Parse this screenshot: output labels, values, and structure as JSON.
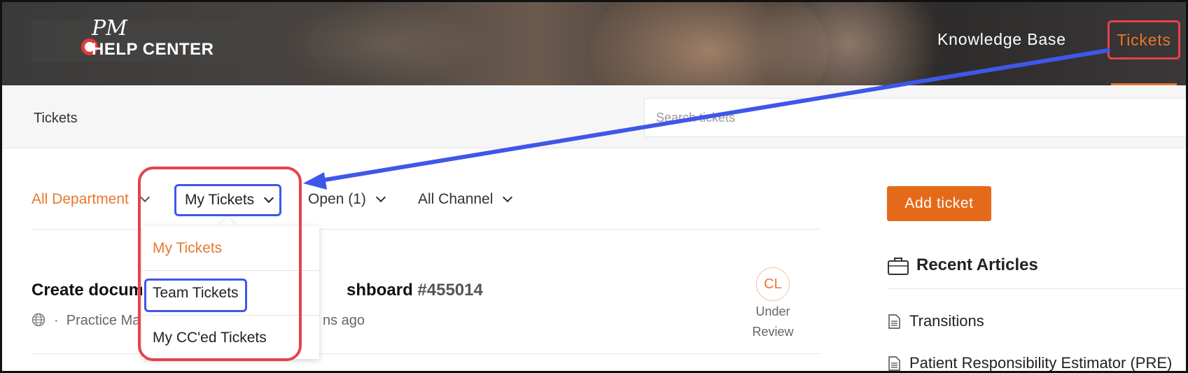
{
  "header": {
    "logo_monogram": "PM",
    "logo_text": "HELP CENTER",
    "nav": [
      {
        "label": "Knowledge Base"
      },
      {
        "label": "Tickets"
      }
    ]
  },
  "subbar": {
    "title": "Tickets",
    "search_placeholder": "Search tickets"
  },
  "filters": {
    "department": "All Department",
    "view": "My Tickets",
    "status": "Open (1)",
    "channel": "All Channel"
  },
  "view_dropdown": {
    "options": [
      {
        "label": "My Tickets",
        "selected": true
      },
      {
        "label": "Team Tickets",
        "selected": false
      },
      {
        "label": "My CC'ed Tickets",
        "selected": false
      }
    ]
  },
  "ticket": {
    "title_visible_left": "Create docum",
    "title_visible_right": "shboard",
    "number": "#455014",
    "meta_visible": "Practice Ma",
    "time_visible": "ns ago",
    "assignee_initials": "CL",
    "status_line1": "Under",
    "status_line2": "Review"
  },
  "sidebar": {
    "add_ticket_label": "Add ticket",
    "recent_articles_title": "Recent Articles",
    "articles": [
      {
        "title": "Transitions"
      },
      {
        "title": "Patient Responsibility Estimator (PRE)"
      }
    ]
  },
  "colors": {
    "brand_orange": "#e8782e",
    "button_orange": "#e46a1a",
    "annotation_red": "#e5434c",
    "annotation_blue": "#3f57e8"
  }
}
